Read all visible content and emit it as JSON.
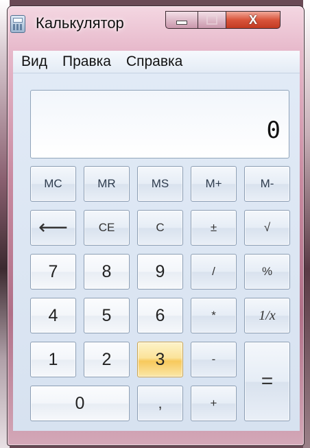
{
  "window": {
    "title": "Калькулятор",
    "icons": {
      "app": "calculator-icon",
      "minimize": "minimize-icon",
      "maximize": "maximize-icon",
      "close": "close-icon"
    },
    "close_glyph": "X"
  },
  "menu": [
    "Вид",
    "Правка",
    "Справка"
  ],
  "display": {
    "value": "0"
  },
  "keys": {
    "mc": "MC",
    "mr": "MR",
    "ms": "MS",
    "mplus": "M+",
    "mminus": "M-",
    "backspace": "⟵",
    "ce": "CE",
    "c": "C",
    "plusminus": "±",
    "sqrt": "√",
    "d7": "7",
    "d8": "8",
    "d9": "9",
    "divide": "/",
    "percent": "%",
    "d4": "4",
    "d5": "5",
    "d6": "6",
    "multiply": "*",
    "reciprocal": "1/x",
    "d1": "1",
    "d2": "2",
    "d3": "3",
    "minus": "-",
    "equals": "=",
    "d0": "0",
    "comma": ",",
    "plus": "+"
  },
  "colors": {
    "active_key": "#f7c95c",
    "close_button": "#d9543b",
    "body": "#dce6f2"
  }
}
